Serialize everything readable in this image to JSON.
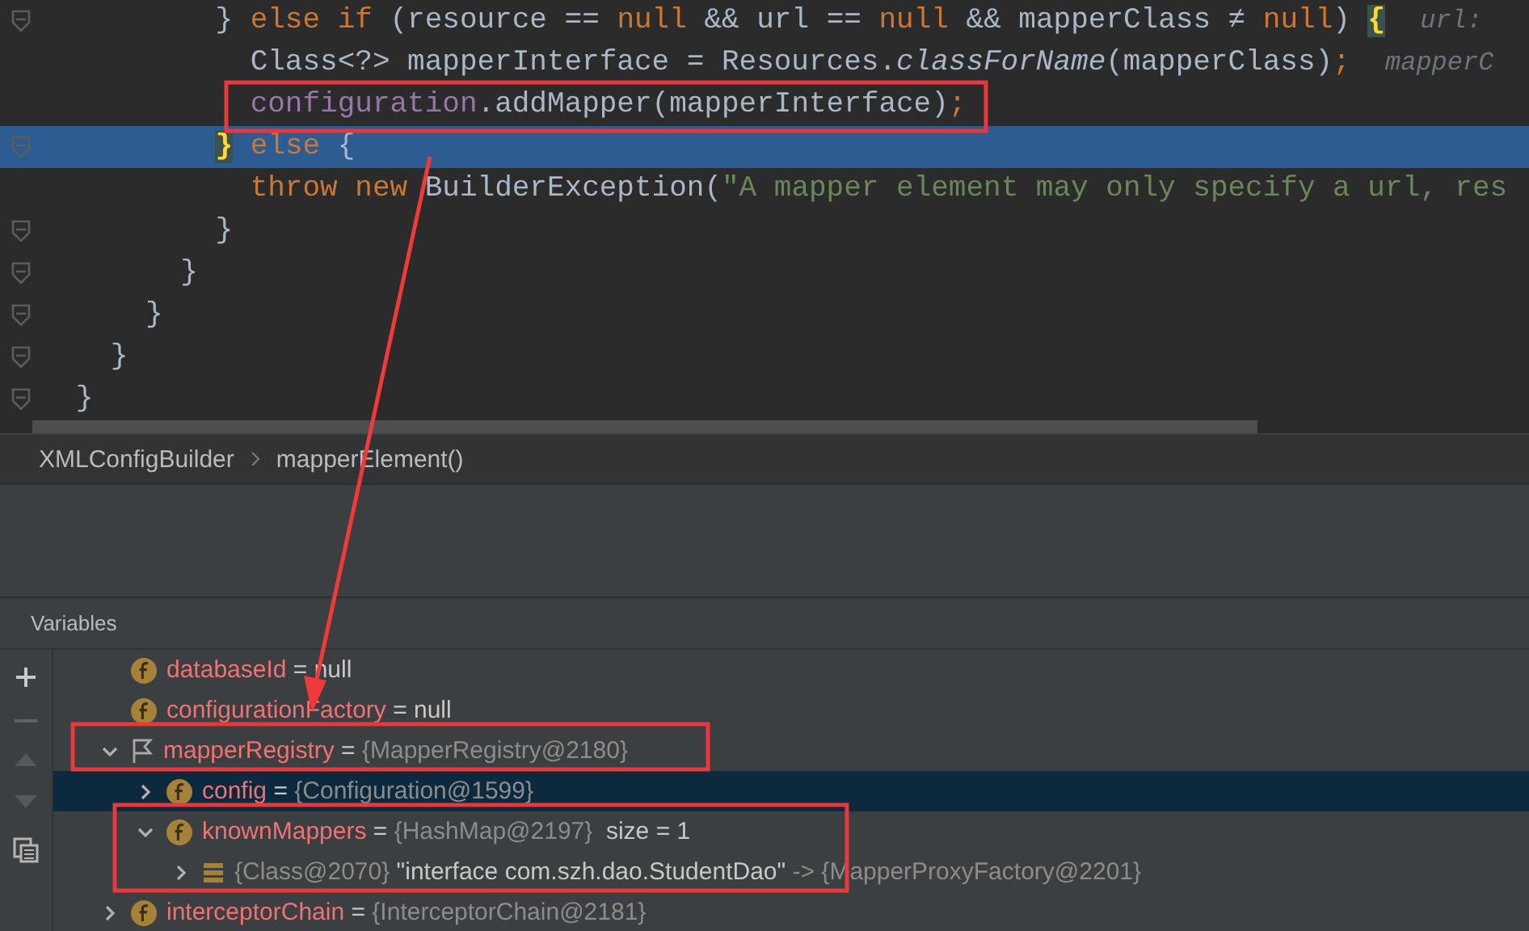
{
  "code": {
    "lines": [
      {
        "fold_marker": true,
        "selected": false,
        "boxed": false,
        "tokens": [
          {
            "t": "         } ",
            "kind": "plain"
          },
          {
            "t": "else if ",
            "kind": "kw"
          },
          {
            "t": "(resource == ",
            "kind": "plain"
          },
          {
            "t": "null",
            "kind": "kw"
          },
          {
            "t": " && url == ",
            "kind": "plain"
          },
          {
            "t": "null",
            "kind": "kw"
          },
          {
            "t": " && mapperClass ≠ ",
            "kind": "plain"
          },
          {
            "t": "null",
            "kind": "kw"
          },
          {
            "t": ") ",
            "kind": "plain"
          },
          {
            "t": "{",
            "kind": "match"
          },
          {
            "t": "  url:",
            "kind": "hint"
          }
        ]
      },
      {
        "fold_marker": false,
        "selected": false,
        "boxed": false,
        "tokens": [
          {
            "t": "           Class<?> mapperInterface = Resources.",
            "kind": "plain"
          },
          {
            "t": "classForName",
            "kind": "italic"
          },
          {
            "t": "(mapperClass)",
            "kind": "plain"
          },
          {
            "t": ";",
            "kind": "kw"
          },
          {
            "t": "  mapperC",
            "kind": "hint"
          }
        ]
      },
      {
        "fold_marker": false,
        "selected": false,
        "boxed": true,
        "tokens": [
          {
            "t": "           configuration",
            "kind": "field"
          },
          {
            "t": ".addMapper(mapperInterface)",
            "kind": "plain"
          },
          {
            "t": ";",
            "kind": "kw"
          }
        ]
      },
      {
        "fold_marker": true,
        "selected": true,
        "boxed": false,
        "tokens": [
          {
            "t": "         }",
            "kind": "match"
          },
          {
            "t": " else ",
            "kind": "kw"
          },
          {
            "t": "{",
            "kind": "plain"
          }
        ]
      },
      {
        "fold_marker": false,
        "selected": false,
        "boxed": false,
        "tokens": [
          {
            "t": "           throw new ",
            "kind": "kw"
          },
          {
            "t": "BuilderException(",
            "kind": "plain"
          },
          {
            "t": "\"A mapper element may only specify a url, res",
            "kind": "string"
          }
        ]
      },
      {
        "fold_marker": true,
        "selected": false,
        "boxed": false,
        "tokens": [
          {
            "t": "         }",
            "kind": "plain"
          }
        ]
      },
      {
        "fold_marker": true,
        "selected": false,
        "boxed": false,
        "tokens": [
          {
            "t": "       }",
            "kind": "plain"
          }
        ]
      },
      {
        "fold_marker": true,
        "selected": false,
        "boxed": false,
        "tokens": [
          {
            "t": "     }",
            "kind": "plain"
          }
        ]
      },
      {
        "fold_marker": true,
        "selected": false,
        "boxed": false,
        "tokens": [
          {
            "t": "   }",
            "kind": "plain"
          }
        ]
      },
      {
        "fold_marker": true,
        "selected": false,
        "boxed": false,
        "tokens": [
          {
            "t": " }",
            "kind": "plain"
          }
        ]
      }
    ]
  },
  "breadcrumbs": [
    "XMLConfigBuilder",
    "mapperElement()"
  ],
  "variables": {
    "title": "Variables",
    "tree": [
      {
        "kind": "field",
        "selected": false,
        "boxed": false,
        "parts": [
          {
            "t": "databaseId",
            "kind": "name"
          },
          {
            "t": " = null",
            "kind": "plain"
          }
        ]
      },
      {
        "kind": "field",
        "selected": false,
        "boxed": false,
        "parts": [
          {
            "t": "configurationFactory",
            "kind": "name"
          },
          {
            "t": " = null",
            "kind": "plain"
          }
        ]
      },
      {
        "kind": "flag",
        "selected": false,
        "boxed": true,
        "expanded": true,
        "parts": [
          {
            "t": "mapperRegistry",
            "kind": "name"
          },
          {
            "t": " = ",
            "kind": "plain"
          },
          {
            "t": "{MapperRegistry@2180}",
            "kind": "ref"
          }
        ],
        "children": [
          {
            "kind": "field",
            "selected": true,
            "boxed": false,
            "expanded": false,
            "parts": [
              {
                "t": "config",
                "kind": "name"
              },
              {
                "t": " = ",
                "kind": "plain"
              },
              {
                "t": "{Configuration@1599}",
                "kind": "ref"
              }
            ]
          },
          {
            "kind": "field",
            "selected": false,
            "boxed": true,
            "expanded": true,
            "parts": [
              {
                "t": "knownMappers",
                "kind": "name"
              },
              {
                "t": " = ",
                "kind": "plain"
              },
              {
                "t": "{HashMap@2197}",
                "kind": "ref"
              },
              {
                "t": "  size = 1",
                "kind": "plain"
              }
            ],
            "children": [
              {
                "kind": "entry",
                "selected": false,
                "boxed": false,
                "expanded": false,
                "parts": [
                  {
                    "t": "{Class@2070} ",
                    "kind": "ref"
                  },
                  {
                    "t": "\"interface com.szh.dao.StudentDao\"",
                    "kind": "plain"
                  },
                  {
                    "t": " -> {MapperProxyFactory@2201}",
                    "kind": "ref"
                  }
                ]
              }
            ]
          }
        ]
      },
      {
        "kind": "field",
        "selected": false,
        "boxed": false,
        "expanded": false,
        "parts": [
          {
            "t": "interceptorChain",
            "kind": "name"
          },
          {
            "t": " = ",
            "kind": "plain"
          },
          {
            "t": "{InterceptorChain@2181}",
            "kind": "ref"
          }
        ]
      }
    ]
  }
}
